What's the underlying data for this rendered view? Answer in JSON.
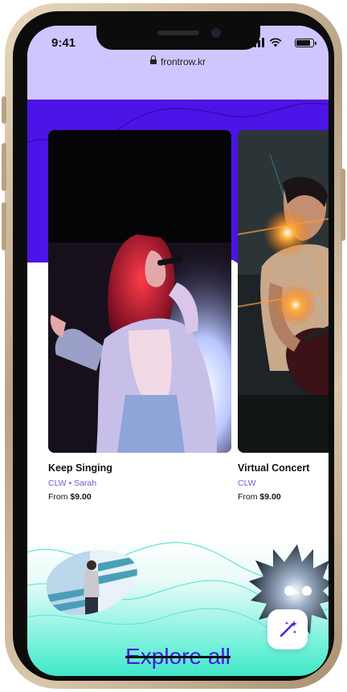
{
  "status_bar": {
    "time": "9:41"
  },
  "browser": {
    "url": "frontrow.kr"
  },
  "cards": [
    {
      "title": "Keep Singing",
      "artist": "CLW • Sarah",
      "price_prefix": "From",
      "price": "$9.00"
    },
    {
      "title": "Virtual Concert",
      "artist": "CLW",
      "price_prefix": "From",
      "price": "$9.00"
    }
  ],
  "explore_link": "Explore all",
  "icons": [
    "lock-icon",
    "signal-icon",
    "wifi-icon",
    "battery-icon",
    "magic-wand-icon"
  ],
  "colors": {
    "brand": "#4c14e6",
    "status_bar": "#d0c6ff",
    "artist_text": "#6b5fc9",
    "mint": "#3fe8c8"
  }
}
